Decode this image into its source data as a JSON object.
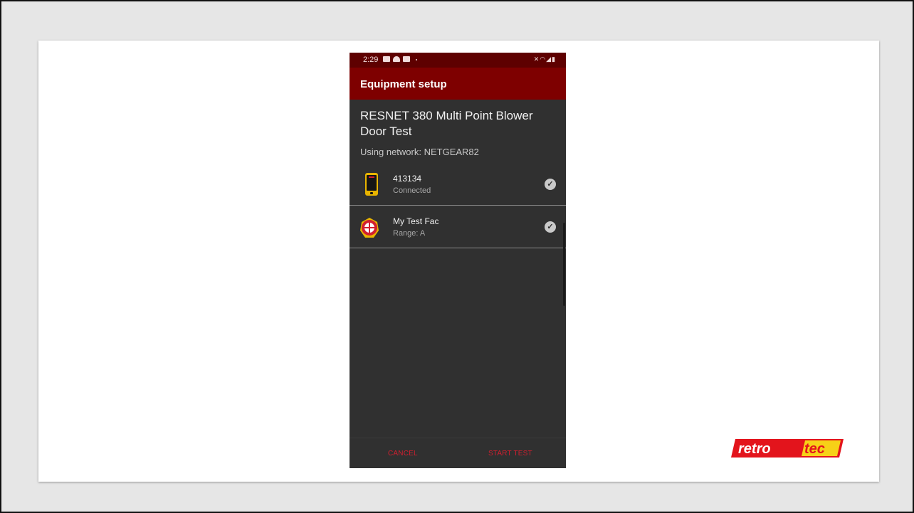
{
  "status_bar": {
    "time": "2:29",
    "icons_left": [
      "youtube-icon",
      "cloud-icon",
      "youtube-icon",
      "dot-icon"
    ],
    "icons_right": [
      "mute-icon",
      "wifi-icon",
      "signal-icon",
      "battery-icon"
    ]
  },
  "app_bar": {
    "title": "Equipment setup"
  },
  "test": {
    "title": "RESNET 380 Multi Point Blower Door Test",
    "network": "Using network: NETGEAR82"
  },
  "devices": [
    {
      "name": "413134",
      "status": "Connected",
      "icon": "gauge-icon",
      "checked": true
    },
    {
      "name": "My Test Fac",
      "status": "Range: A",
      "icon": "fan-icon",
      "checked": true
    }
  ],
  "actions": {
    "cancel": "CANCEL",
    "start": "START TEST"
  },
  "logo": {
    "text": "retrotec",
    "part1": "retro",
    "part2": "tec"
  },
  "colors": {
    "accent": "#d21f2f",
    "app_bar": "#7e0000",
    "status_bar": "#5e0000",
    "screen_bg": "#303030",
    "logo_red": "#e3141c",
    "logo_yellow": "#f7d117"
  }
}
